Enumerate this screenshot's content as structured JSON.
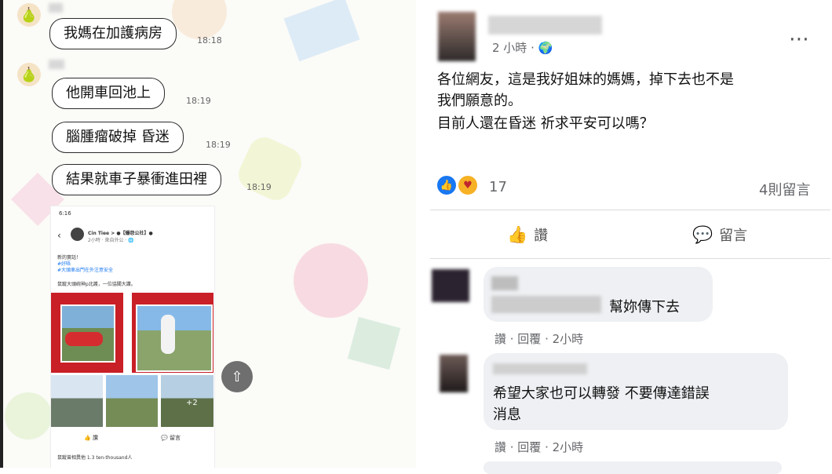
{
  "chat": {
    "messages": [
      {
        "text": "我媽在加護病房",
        "time": "18:18"
      },
      {
        "text": "他開車回池上",
        "time": "18:19"
      },
      {
        "text": "腦腫瘤破掉 昏迷",
        "time": "18:19"
      },
      {
        "text": "結果就車子暴衝進田裡",
        "time": "18:19"
      }
    ],
    "embedded_post": {
      "status_time": "6:16",
      "user": "Cin Tiee > ●【爆怨公社】●",
      "meta": "2小時 · 來自外公 · 🌐",
      "text_lines": [
        "新的實話！",
        "#好唔",
        "#大頭車出門在外注意安全",
        "鼠蹤大頭碗神p北護，一位協關大讚。"
      ],
      "reactions": "鼠蹤曾相異他 1.3 ten-thousand人"
    }
  },
  "post": {
    "time": "2 小時 · 🌍",
    "lines": [
      "各位網友，這是我好姐妹的媽媽，掉下去也不是",
      "我們願意的。",
      "目前人還在昏迷 祈求平安可以嗎？"
    ],
    "reaction_count": "17",
    "comments_count": "4則留言",
    "like_label": "讚",
    "comment_label": "留言",
    "comments": [
      {
        "text": "幫妳傳下去",
        "actions": "讚 · 回覆 · 2小時"
      },
      {
        "text_lines": [
          "希望大家也可以轉發 不要傳達錯誤",
          "消息"
        ],
        "actions": "讚 · 回覆 · 2小時"
      }
    ]
  },
  "colors": {
    "blue": "#1877f2",
    "orange": "#f7b125",
    "gray": "#65676b"
  }
}
